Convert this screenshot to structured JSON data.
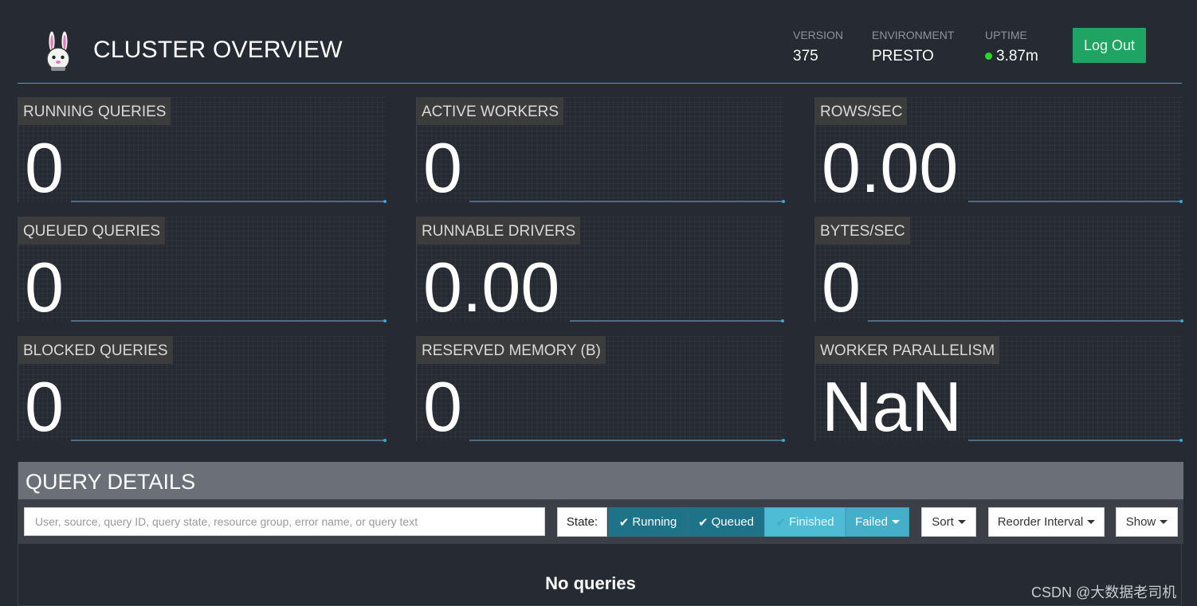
{
  "header": {
    "title": "CLUSTER OVERVIEW",
    "logo_icon": "presto-bunny-logo",
    "version_label": "VERSION",
    "version_value": "375",
    "environment_label": "ENVIRONMENT",
    "environment_value": "PRESTO",
    "uptime_label": "UPTIME",
    "uptime_value": "3.87m",
    "uptime_status_color": "#2bd62b",
    "logout_label": "Log Out"
  },
  "tiles": [
    {
      "label": "RUNNING QUERIES",
      "value": "0"
    },
    {
      "label": "ACTIVE WORKERS",
      "value": "0"
    },
    {
      "label": "ROWS/SEC",
      "value": "0.00"
    },
    {
      "label": "QUEUED QUERIES",
      "value": "0"
    },
    {
      "label": "RUNNABLE DRIVERS",
      "value": "0.00"
    },
    {
      "label": "BYTES/SEC",
      "value": "0"
    },
    {
      "label": "BLOCKED QUERIES",
      "value": "0"
    },
    {
      "label": "RESERVED MEMORY (B)",
      "value": "0"
    },
    {
      "label": "WORKER PARALLELISM",
      "value": "NaN"
    }
  ],
  "query_details": {
    "title": "QUERY DETAILS",
    "search_placeholder": "User, source, query ID, query state, resource group, error name, or query text",
    "state_label": "State:",
    "state_filters": {
      "running": "Running",
      "queued": "Queued",
      "finished": "Finished",
      "failed": "Failed"
    },
    "sort_label": "Sort",
    "reorder_label": "Reorder Interval",
    "show_label": "Show",
    "empty_message": "No queries"
  },
  "watermark": "CSDN @大数据老司机",
  "colors": {
    "background": "#252a33",
    "accent": "#3aa7d6",
    "logout": "#1fa463",
    "filter_active": "#1f7389"
  }
}
